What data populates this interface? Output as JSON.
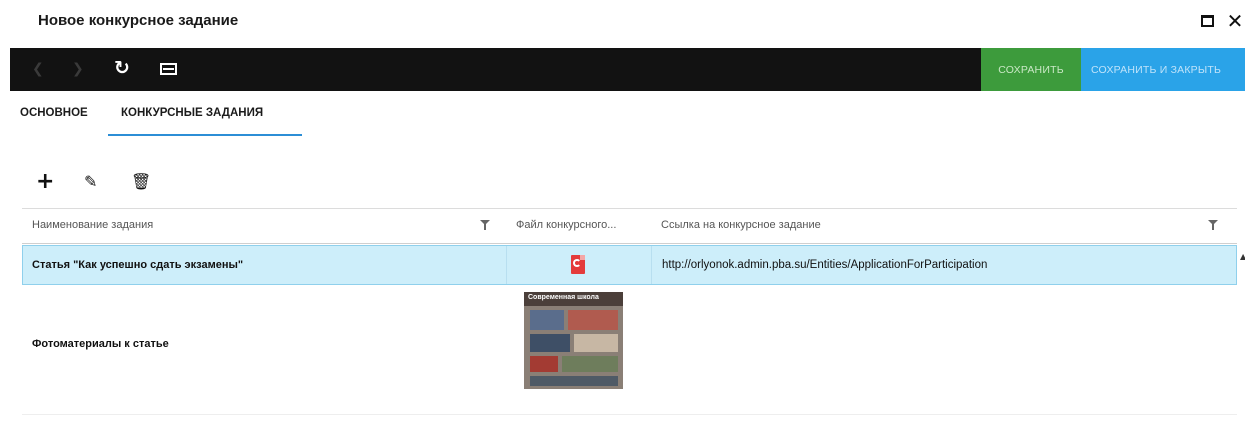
{
  "window": {
    "title": "Новое конкурсное задание"
  },
  "toolbar": {
    "save_label": "СОХРАНИТЬ",
    "save_close_label": "СОХРАНИТЬ И ЗАКРЫТЬ",
    "save_color": "#3d9b3c",
    "save_close_color": "#2aa3e8",
    "background_color": "#121212"
  },
  "tabs": [
    {
      "label": "ОСНОВНОЕ",
      "active": false
    },
    {
      "label": "КОНКУРСНЫЕ ЗАДАНИЯ",
      "active": true
    }
  ],
  "icons": {
    "add": "plus-icon",
    "edit": "pencil-icon",
    "delete": "trash-icon",
    "refresh": "refresh-icon",
    "screen": "monitor-icon",
    "filter": "filter-icon",
    "file": "pdf-file-icon"
  },
  "grid": {
    "columns": [
      {
        "label": "Наименование задания",
        "filter": true
      },
      {
        "label": "Файл конкурсного...",
        "filter": false
      },
      {
        "label": "Ссылка на конкурсное задание",
        "filter": true
      }
    ],
    "rows": [
      {
        "name": "Статья \"Как успешно сдать экзамены\"",
        "file": "pdf",
        "link": "http://orlyonok.admin.pba.su/Entities/ApplicationForParticipation",
        "selected": true
      },
      {
        "name": "Фотоматериалы к статье",
        "file": "image",
        "file_caption": "Современная школа",
        "link": "",
        "selected": false
      }
    ]
  }
}
